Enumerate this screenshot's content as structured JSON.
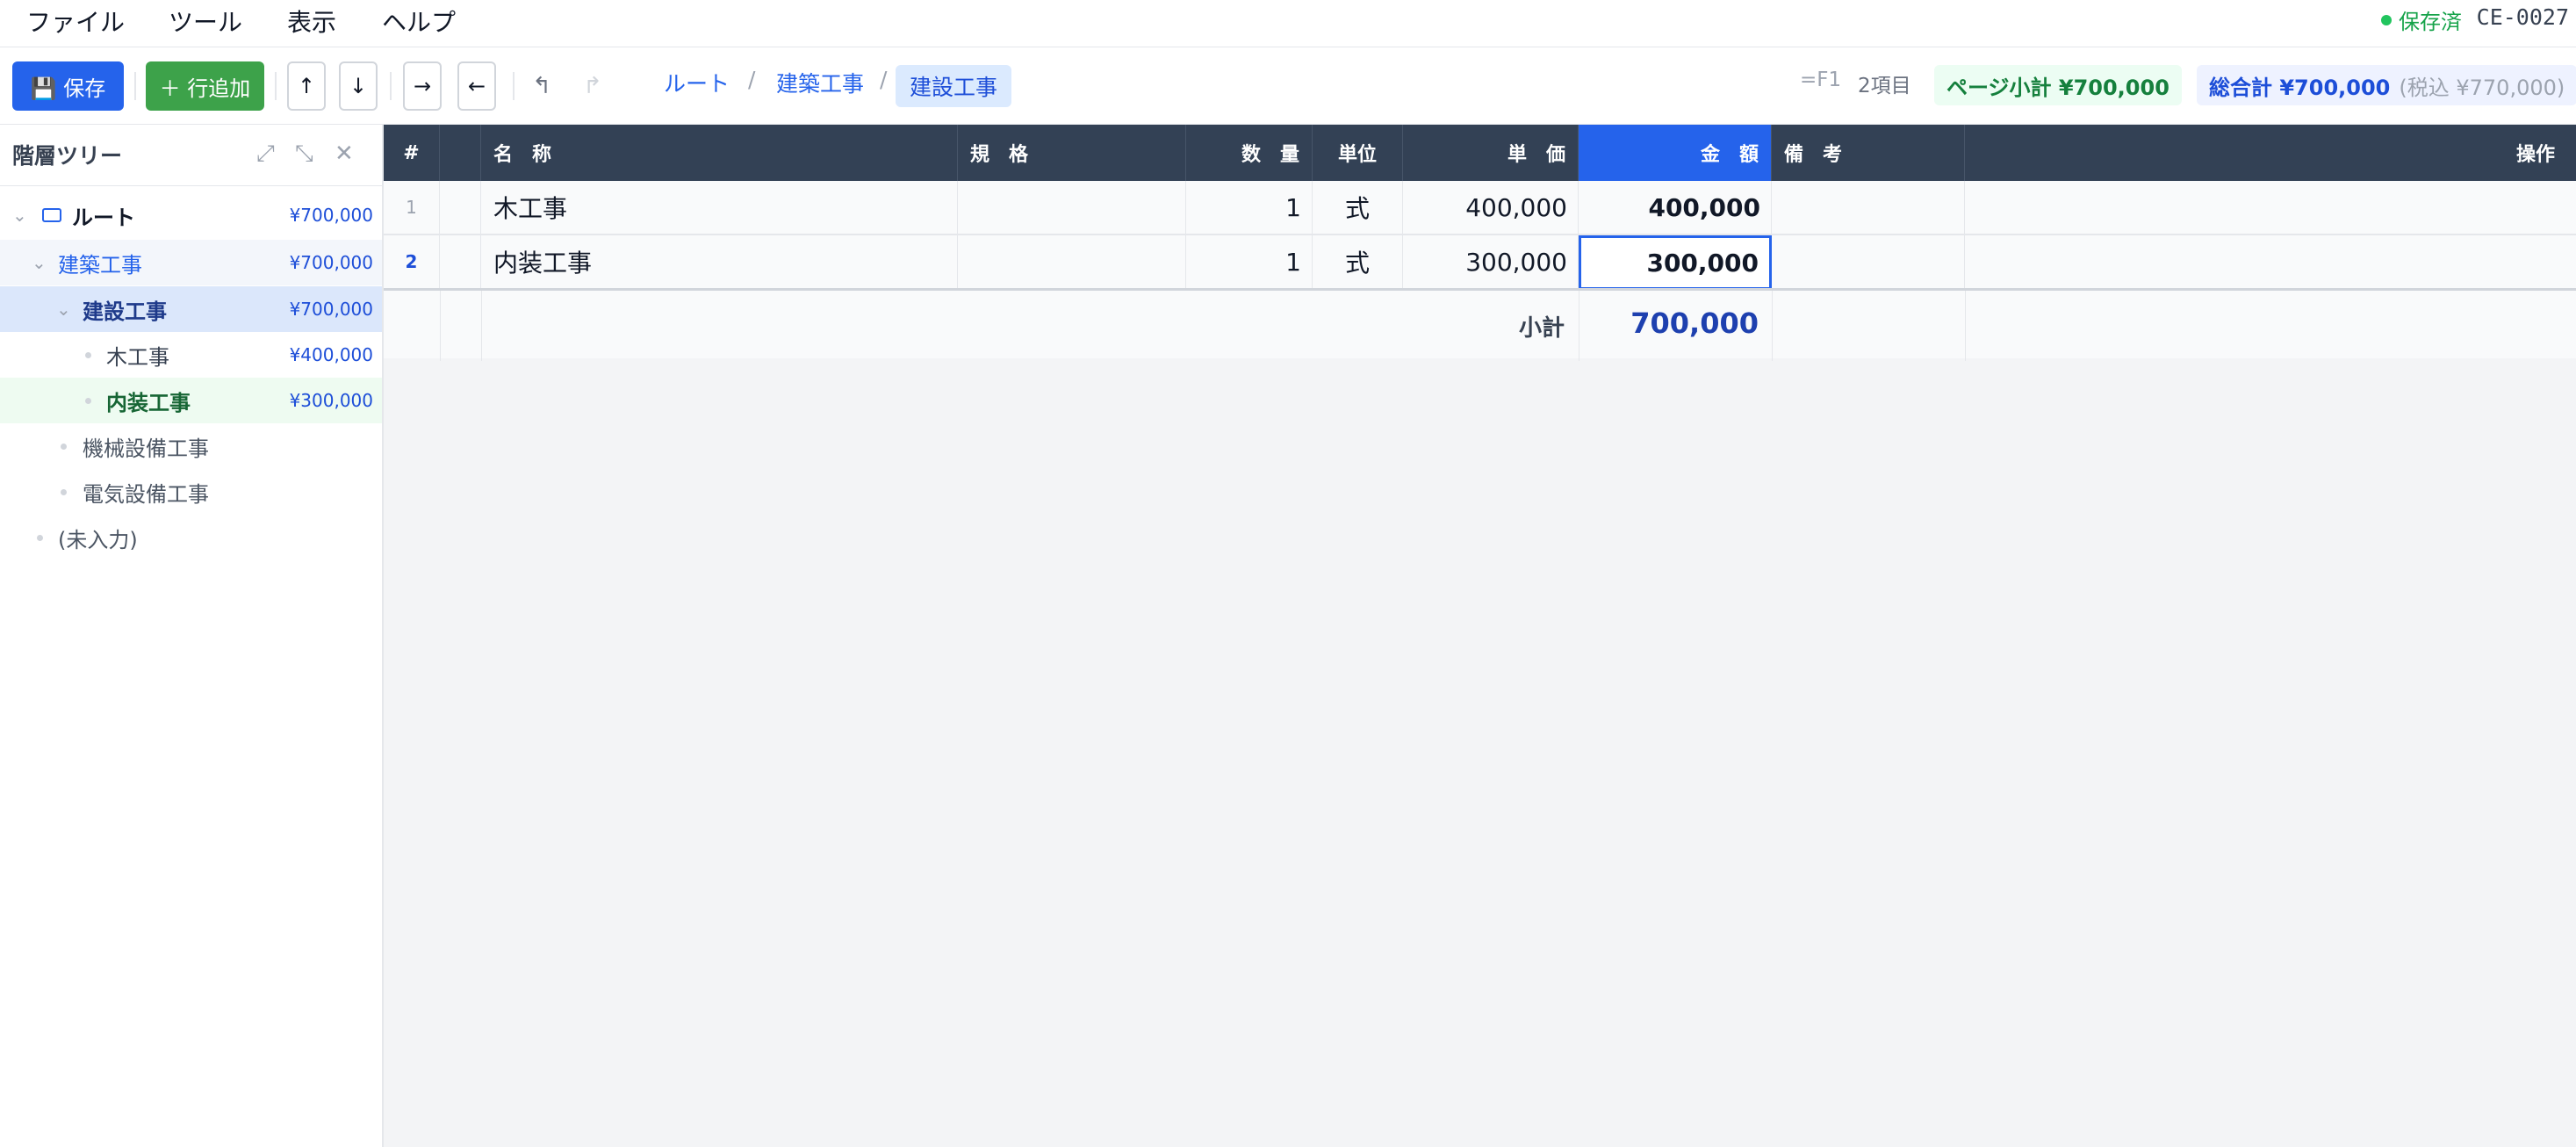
{
  "menu": {
    "file": "ファイル",
    "tools": "ツール",
    "view": "表示",
    "help": "ヘルプ"
  },
  "status": {
    "saved": "保存済",
    "doc_id": "CE-0027"
  },
  "toolbar": {
    "save_label": "💾 保存",
    "add_row_label": "＋ 行追加",
    "move_up": "↑",
    "move_down": "↓",
    "indent": "→",
    "outdent": "←",
    "undo": "↰",
    "redo": "↱",
    "breadcrumb": [
      "ルート",
      "建築工事",
      "建設工事"
    ],
    "shortcut": "=F1",
    "item_count": "2項目",
    "page_subtotal": "ページ小計 ¥700,000",
    "grand_total": "総合計 ¥700,000",
    "tax_included": "(税込 ¥770,000)"
  },
  "sidebar": {
    "title": "階層ツリー",
    "tree": [
      {
        "label": "ルート",
        "amount": "¥700,000"
      },
      {
        "label": "建築工事",
        "amount": "¥700,000"
      },
      {
        "label": "建設工事",
        "amount": "¥700,000"
      },
      {
        "label": "木工事",
        "amount": "¥400,000"
      },
      {
        "label": "内装工事",
        "amount": "¥300,000"
      },
      {
        "label": "機械設備工事",
        "amount": ""
      },
      {
        "label": "電気設備工事",
        "amount": ""
      },
      {
        "label": "(未入力)",
        "amount": ""
      }
    ]
  },
  "table": {
    "headers": {
      "index": "#",
      "name": "名　称",
      "spec": "規　格",
      "qty": "数　量",
      "unit": "単位",
      "price": "単　価",
      "amount": "金　額",
      "note": "備　考",
      "ops": "操作"
    },
    "rows": [
      {
        "index": "1",
        "name": "木工事",
        "spec": "",
        "qty": "1",
        "unit": "式",
        "price": "400,000",
        "amount": "400,000",
        "note": ""
      },
      {
        "index": "2",
        "name": "内装工事",
        "spec": "",
        "qty": "1",
        "unit": "式",
        "price": "300,000",
        "amount": "300,000",
        "note": ""
      }
    ],
    "subtotal_label": "小計",
    "subtotal_value": "700,000"
  }
}
